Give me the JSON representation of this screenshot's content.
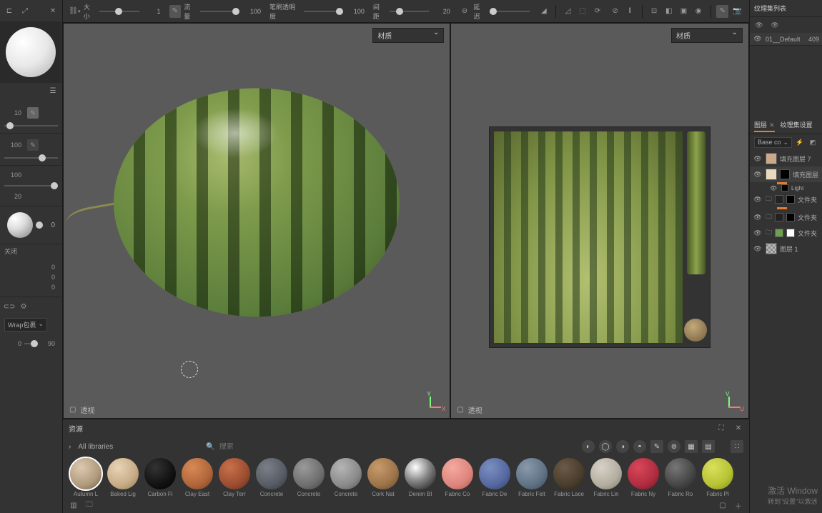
{
  "topbar": {
    "brush_dd": "",
    "size_label": "大小",
    "size_value": "1",
    "flow_label": "流量",
    "flow_value": "100",
    "opacity_label": "笔刷透明度",
    "opacity_value": "100",
    "spacing_label": "间距",
    "spacing_value": "20",
    "lazy_label": "延迟"
  },
  "viewport": {
    "material_dd": "材质",
    "footer_3d": "透视",
    "footer_uv": "透视",
    "axis_y": "Y",
    "axis_x": "X",
    "uv_axis_y": "V",
    "uv_axis_x": "U"
  },
  "leftbar": {
    "prop1_value": "10",
    "prop2_value": "100",
    "prop3_value": "100",
    "prop4_value": "20",
    "label_closed": "关闭",
    "bottom_0a": "0",
    "bottom_0b": "0",
    "bottom_0c": "0",
    "wrap_dd": "Wrap包裹",
    "angle_0": "0",
    "angle_90": "90"
  },
  "assets": {
    "title": "资源",
    "libraries": "All libraries",
    "search_placeholder": "搜索",
    "items": [
      {
        "name": "Autumn L",
        "color": "radial-gradient(circle at 35% 30%,#ddc9b0,#b09a7c 60%,#6b5a40)"
      },
      {
        "name": "Baked Lig",
        "color": "radial-gradient(circle at 35% 30%,#e8d4b8,#c7ab85 60%,#8f7755)"
      },
      {
        "name": "Carbon Fi",
        "color": "radial-gradient(circle at 35% 30%,#333,#111 60%,#000)"
      },
      {
        "name": "Clay East",
        "color": "radial-gradient(circle at 35% 30%,#d88a55,#b0653a 60%,#6f3e22)"
      },
      {
        "name": "Clay Terr",
        "color": "radial-gradient(circle at 35% 30%,#c9704a,#9b4d30 60%,#5e2e1c)"
      },
      {
        "name": "Concrete",
        "color": "radial-gradient(circle at 35% 30%,#7a7f88,#565b64 60%,#33363c)"
      },
      {
        "name": "Concrete",
        "color": "radial-gradient(circle at 35% 30%,#9a9a9a,#6e6e6e 60%,#414141)"
      },
      {
        "name": "Concrete",
        "color": "radial-gradient(circle at 35% 30%,#b5b5b5,#8a8a8a 60%,#555)"
      },
      {
        "name": "Cork Nat",
        "color": "radial-gradient(circle at 35% 30%,#c79a6b,#9c7449 60%,#5d4429)"
      },
      {
        "name": "Denim Bl",
        "color": "radial-gradient(circle at 35% 30%,#fff,#888 45%,#111)"
      },
      {
        "name": "Fabric Co",
        "color": "radial-gradient(circle at 35% 30%,#f4a9a0,#dd857c 60%,#a85a52)"
      },
      {
        "name": "Fabric De",
        "color": "radial-gradient(circle at 35% 30%,#7a8fbf,#5568a0 60%,#2f3c66)"
      },
      {
        "name": "Fabric Felt",
        "color": "radial-gradient(circle at 35% 30%,#8899aa,#5f7285 60%,#384653)"
      },
      {
        "name": "Fabric Lace",
        "color": "radial-gradient(circle at 35% 30%,#6b5a47,#4a3d2d 60%,#271f15)"
      },
      {
        "name": "Fabric Lin",
        "color": "radial-gradient(circle at 35% 30%,#d7d2c8,#b3ad9f 60%,#7a7468)"
      },
      {
        "name": "Fabric Ny",
        "color": "radial-gradient(circle at 35% 30%,#d8475a,#b02c3f 60%,#6d1826)"
      },
      {
        "name": "Fabric Ro",
        "color": "radial-gradient(circle at 35% 30%,#777,#444 60%,#222)"
      },
      {
        "name": "Fabric Pl",
        "color": "radial-gradient(circle at 35% 30%,#d9e05a,#b6c233 60%,#7a861c)"
      }
    ]
  },
  "rightpanel": {
    "texset_title": "纹理集列表",
    "texset_item": "01__Default",
    "texset_res": "409",
    "tab_layers": "图层",
    "tab_texset": "纹理集设置",
    "channel_dd": "Base co",
    "layer_fill7": "填充图层 7",
    "layer_fill": "填充图层",
    "layer_sub_light": "Light",
    "layer_folder1": "文件夹",
    "layer_folder2": "文件夹",
    "layer_folder3": "文件夹",
    "layer_layer1": "图层 1"
  },
  "watermark": {
    "line1": "激活 Window",
    "line2": "转到\"设置\"以激活"
  }
}
